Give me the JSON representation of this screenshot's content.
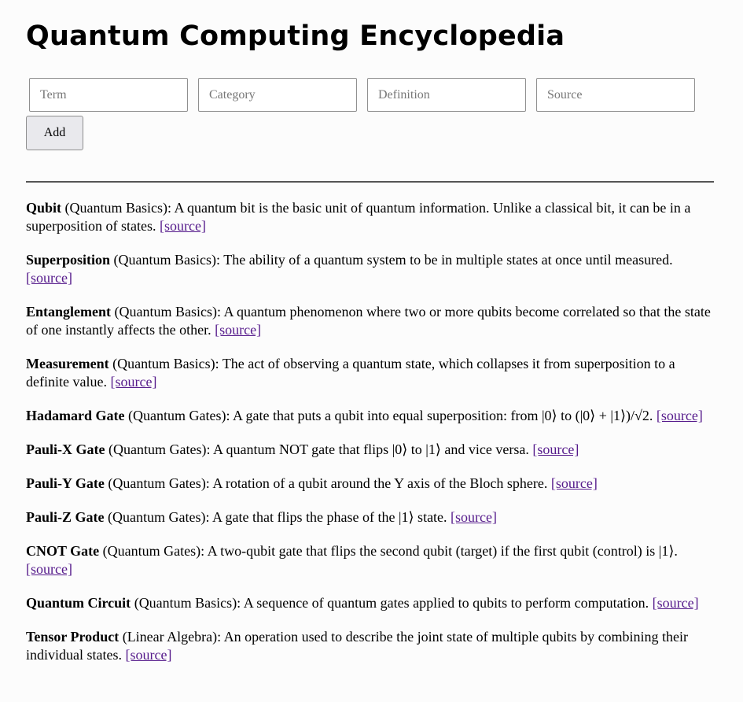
{
  "page": {
    "title": "Quantum Computing Encyclopedia"
  },
  "form": {
    "term_placeholder": "Term",
    "category_placeholder": "Category",
    "definition_placeholder": "Definition",
    "source_placeholder": "Source",
    "add_label": "Add"
  },
  "entries": [
    {
      "term": "Qubit",
      "category": "Quantum Basics",
      "definition": "A quantum bit is the basic unit of quantum information. Unlike a classical bit, it can be in a superposition of states.",
      "link": "[source]"
    },
    {
      "term": "Superposition",
      "category": "Quantum Basics",
      "definition": "The ability of a quantum system to be in multiple states at once until measured.",
      "link": "[source]"
    },
    {
      "term": "Entanglement",
      "category": "Quantum Basics",
      "definition": "A quantum phenomenon where two or more qubits become correlated so that the state of one instantly affects the other.",
      "link": "[source]"
    },
    {
      "term": "Measurement",
      "category": "Quantum Basics",
      "definition": "The act of observing a quantum state, which collapses it from superposition to a definite value.",
      "link": "[source]"
    },
    {
      "term": "Hadamard Gate",
      "category": "Quantum Gates",
      "definition": "A gate that puts a qubit into equal superposition: from |0⟩ to (|0⟩ + |1⟩)/√2.",
      "link": "[source]"
    },
    {
      "term": "Pauli-X Gate",
      "category": "Quantum Gates",
      "definition": "A quantum NOT gate that flips |0⟩ to |1⟩ and vice versa.",
      "link": "[source]"
    },
    {
      "term": "Pauli-Y Gate",
      "category": "Quantum Gates",
      "definition": "A rotation of a qubit around the Y axis of the Bloch sphere.",
      "link": "[source]"
    },
    {
      "term": "Pauli-Z Gate",
      "category": "Quantum Gates",
      "definition": "A gate that flips the phase of the |1⟩ state.",
      "link": "[source]"
    },
    {
      "term": "CNOT Gate",
      "category": "Quantum Gates",
      "definition": "A two-qubit gate that flips the second qubit (target) if the first qubit (control) is |1⟩.",
      "link": "[source]"
    },
    {
      "term": "Quantum Circuit",
      "category": "Quantum Basics",
      "definition": "A sequence of quantum gates applied to qubits to perform computation.",
      "link": "[source]"
    },
    {
      "term": "Tensor Product",
      "category": "Linear Algebra",
      "definition": "An operation used to describe the joint state of multiple qubits by combining their individual states.",
      "link": "[source]"
    }
  ],
  "colors": {
    "link_visited": "#551a8b",
    "background": "#fcfcfc",
    "divider": "#555555"
  }
}
